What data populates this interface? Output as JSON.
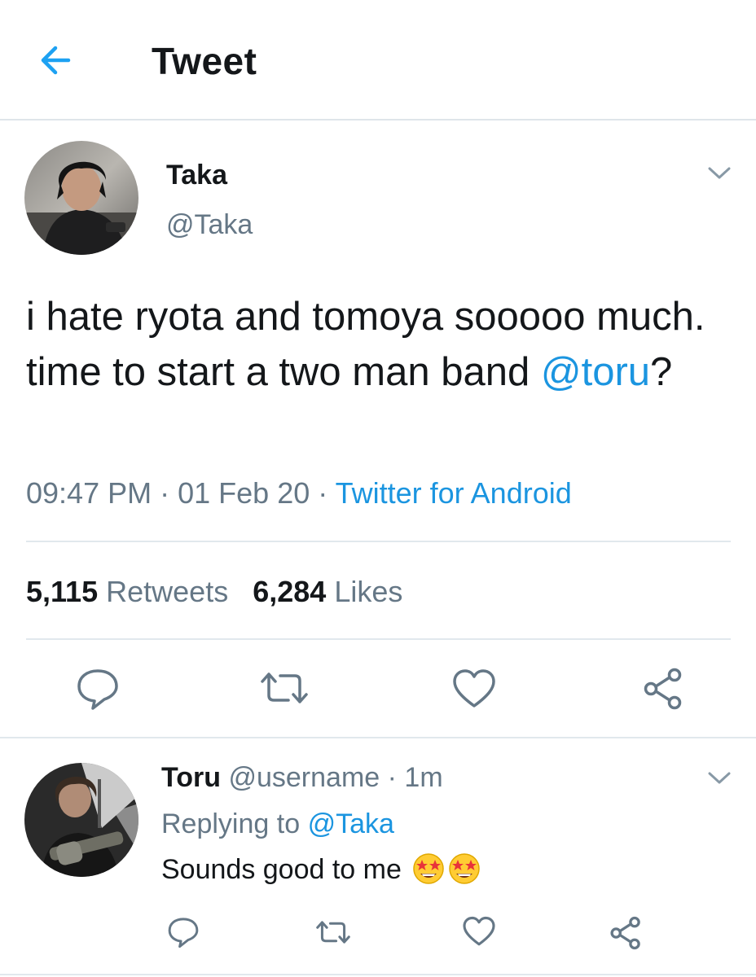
{
  "header": {
    "title": "Tweet",
    "back_icon": "arrow-left-icon"
  },
  "colors": {
    "accent": "#1b95e0",
    "secondary_text": "#657786",
    "divider": "#e1e8ed"
  },
  "tweet": {
    "display_name": "Taka",
    "handle": "@Taka",
    "text_before": "i hate ryota and tomoya sooooo much. time to start a two man band ",
    "mention": "@toru",
    "text_after": "?",
    "time": "09:47 PM",
    "separator": "·",
    "date": "01 Feb 20",
    "source": "Twitter for Android",
    "retweet_count": "5,115",
    "retweet_label": "Retweets",
    "like_count": "6,284",
    "like_label": "Likes"
  },
  "reply": {
    "display_name": "Toru",
    "handle": "@username",
    "separator": "·",
    "age": "1m",
    "replying_label": "Replying to",
    "replying_to": "@Taka",
    "text": "Sounds good to me",
    "emojis": [
      "star-struck-emoji",
      "star-struck-emoji"
    ]
  }
}
